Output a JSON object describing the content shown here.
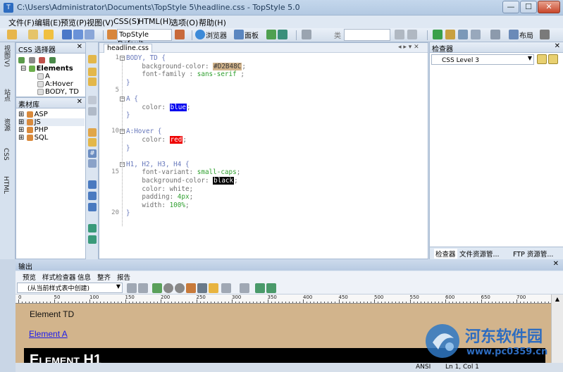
{
  "window": {
    "title": "C:\\Users\\Administrator\\Documents\\TopStyle 5\\headline.css - TopStyle 5.0",
    "minimize": "—",
    "maximize": "☐",
    "close": "✕"
  },
  "menu": [
    "文件(F)",
    "编辑(E)",
    "预览(P)",
    "视图(V)",
    "CSS(S)",
    "HTML(H)",
    "选项(O)",
    "帮助(H)"
  ],
  "toolbar": {
    "style_combo": "TopStyle Default",
    "browser_label": "浏览器",
    "panel_label": "面板",
    "class_label": "类",
    "layout_label": "布局"
  },
  "left_tabs": [
    "视图(V)",
    "站点",
    "资源",
    "CSS",
    "HTML"
  ],
  "css_selector_panel": {
    "title": "CSS 选择器",
    "close": "✕",
    "items": [
      "Elements",
      "A",
      "A:Hover",
      "BODY, TD"
    ]
  },
  "assets_panel": {
    "title": "素材库",
    "close": "✕",
    "items": [
      "ASP",
      "JS",
      "PHP",
      "SQL"
    ]
  },
  "editor": {
    "tab": "headline.css",
    "lines": [
      {
        "n": "1",
        "fold": "⊟",
        "parts": [
          {
            "t": "BODY, TD {",
            "c": "sel"
          }
        ]
      },
      {
        "n": "",
        "fold": "",
        "parts": [
          {
            "t": "    background-color: ",
            "c": "prop"
          },
          {
            "t": "#D2B48C",
            "c": "hl",
            "bg": "#d2b48c",
            "fg": "#333"
          },
          {
            "t": ";",
            "c": "prop"
          }
        ]
      },
      {
        "n": "",
        "fold": "",
        "parts": [
          {
            "t": "    font-family : ",
            "c": "prop"
          },
          {
            "t": "sans-serif",
            "c": "val"
          },
          {
            "t": " ;",
            "c": "prop"
          }
        ]
      },
      {
        "n": "",
        "fold": "",
        "parts": [
          {
            "t": "}",
            "c": "sel"
          }
        ]
      },
      {
        "n": "5",
        "fold": "",
        "parts": []
      },
      {
        "n": "",
        "fold": "⊟",
        "parts": [
          {
            "t": "A {",
            "c": "sel"
          }
        ]
      },
      {
        "n": "",
        "fold": "",
        "parts": [
          {
            "t": "    color: ",
            "c": "prop"
          },
          {
            "t": "blue",
            "c": "hl",
            "bg": "#0000ee",
            "fg": "#ffffff"
          },
          {
            "t": ";",
            "c": "prop"
          }
        ]
      },
      {
        "n": "",
        "fold": "",
        "parts": [
          {
            "t": "}",
            "c": "sel"
          }
        ]
      },
      {
        "n": "",
        "fold": "",
        "parts": []
      },
      {
        "n": "10",
        "fold": "⊟",
        "parts": [
          {
            "t": "A:Hover {",
            "c": "sel"
          }
        ]
      },
      {
        "n": "",
        "fold": "",
        "parts": [
          {
            "t": "    color: ",
            "c": "prop"
          },
          {
            "t": "red",
            "c": "hl",
            "bg": "#ee0000",
            "fg": "#ffffff"
          },
          {
            "t": ";",
            "c": "prop"
          }
        ]
      },
      {
        "n": "",
        "fold": "",
        "parts": [
          {
            "t": "}",
            "c": "sel"
          }
        ]
      },
      {
        "n": "",
        "fold": "",
        "parts": []
      },
      {
        "n": "",
        "fold": "⊟",
        "parts": [
          {
            "t": "H1, H2, H3, H4 {",
            "c": "sel"
          }
        ]
      },
      {
        "n": "15",
        "fold": "",
        "parts": [
          {
            "t": "    font-variant: ",
            "c": "prop"
          },
          {
            "t": "small-caps",
            "c": "val"
          },
          {
            "t": ";",
            "c": "prop"
          }
        ]
      },
      {
        "n": "",
        "fold": "",
        "parts": [
          {
            "t": "    background-color: ",
            "c": "prop"
          },
          {
            "t": "black",
            "c": "hl",
            "bg": "#000000",
            "fg": "#ffffff"
          },
          {
            "t": ";",
            "c": "prop"
          }
        ]
      },
      {
        "n": "",
        "fold": "",
        "parts": [
          {
            "t": "    color: white;",
            "c": "prop"
          }
        ]
      },
      {
        "n": "",
        "fold": "",
        "parts": [
          {
            "t": "    padding: ",
            "c": "prop"
          },
          {
            "t": "4px",
            "c": "val"
          },
          {
            "t": ";",
            "c": "prop"
          }
        ]
      },
      {
        "n": "",
        "fold": "",
        "parts": [
          {
            "t": "    width: ",
            "c": "prop"
          },
          {
            "t": "100%",
            "c": "val"
          },
          {
            "t": ";",
            "c": "prop"
          }
        ]
      },
      {
        "n": "20",
        "fold": "",
        "parts": [
          {
            "t": "}",
            "c": "sel"
          }
        ]
      }
    ]
  },
  "inspector": {
    "title": "检查器",
    "close": "✕",
    "level": "CSS Level 3",
    "tabs": [
      "检查器",
      "文件资源管...",
      "FTP 资源管..."
    ]
  },
  "output": {
    "title": "输出",
    "close": "✕",
    "tabs": [
      "预览",
      "样式检查器",
      "信息",
      "整齐",
      "报告"
    ],
    "source_combo": "(从当前样式表中创建)",
    "ruler": [
      "0",
      "50",
      "100",
      "150",
      "200",
      "250",
      "300",
      "350",
      "400",
      "450",
      "500",
      "550",
      "600",
      "650",
      "700"
    ],
    "preview": {
      "td": "Element TD",
      "a": "Element A",
      "h1": "Element H1"
    },
    "status": {
      "encoding": "ANSI",
      "position": "Ln 1, Col 1"
    }
  },
  "watermark": {
    "name": "河东软件园",
    "url": "www.pc0359.cn"
  },
  "colors": {
    "preview_bg": "#d2b48c",
    "accent": "#2d6cc0"
  }
}
